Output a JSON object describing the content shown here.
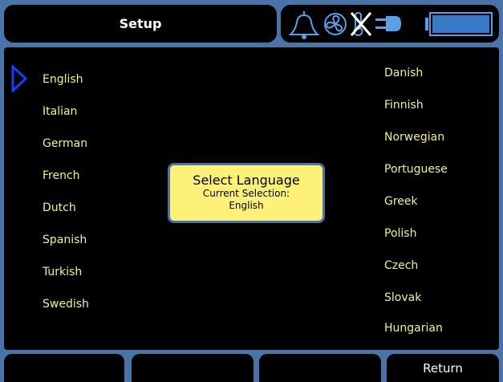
{
  "header": {
    "title": "Setup"
  },
  "status_icons": [
    "bell-icon",
    "fan-icon",
    "no-thermometer-icon",
    "power-plug-icon",
    "battery-icon"
  ],
  "languages_left": [
    "English",
    "Italian",
    "German",
    "French",
    "Dutch",
    "Spanish",
    "Turkish",
    "Swedish"
  ],
  "languages_right": [
    "Danish",
    "Finnish",
    "Norwegian",
    "Portuguese",
    "Greek",
    "Polish",
    "Czech",
    "Slovak",
    "Hungarian"
  ],
  "selected_language": "English",
  "dialog": {
    "title": "Select Language",
    "subtitle": "Current Selection:",
    "value": "English"
  },
  "softkeys": [
    "",
    "",
    "",
    "Return"
  ],
  "colors": {
    "frame": "#4a73a8",
    "panel": "#000000",
    "language_text": "#f4f08e",
    "dialog_bg": "#fdf17a",
    "cursor": "#1a3cff",
    "status_icon": "#5a9fe6"
  }
}
